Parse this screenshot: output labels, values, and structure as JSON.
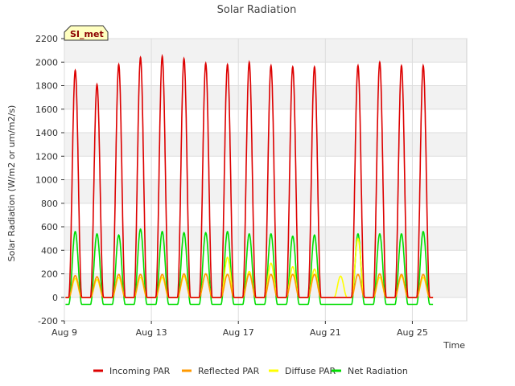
{
  "chart_data": {
    "type": "line",
    "title": "Solar Radiation",
    "xlabel": "Time",
    "ylabel": "Solar Radiation (W/m2 or um/m2/s)",
    "ylim": [
      -200,
      2200
    ],
    "xlim": [
      0,
      18.5
    ],
    "yticks": [
      -200,
      0,
      200,
      400,
      600,
      800,
      1000,
      1200,
      1400,
      1600,
      1800,
      2000,
      2200
    ],
    "xticks": [
      {
        "label": "Aug 9",
        "day": 0
      },
      {
        "label": "Aug 13",
        "day": 4
      },
      {
        "label": "Aug 17",
        "day": 8
      },
      {
        "label": "Aug 21",
        "day": 12
      },
      {
        "label": "Aug 25",
        "day": 16
      }
    ],
    "grid": true,
    "legend_position": "bottom",
    "site_label": "SI_met",
    "series": [
      {
        "name": "Incoming PAR",
        "color": "#dd0000",
        "x_day": [
          0.5,
          1.5,
          2.5,
          3.5,
          4.5,
          5.5,
          6.5,
          7.5,
          8.5,
          9.5,
          10.5,
          11.5,
          13.5,
          14.5,
          15.5,
          16.5
        ],
        "peak_values": [
          1930,
          1810,
          1980,
          2040,
          2050,
          2030,
          1990,
          1980,
          2000,
          1970,
          1960,
          1960,
          1970,
          2000,
          1970,
          1970
        ]
      },
      {
        "name": "Reflected PAR",
        "color": "#ff9900",
        "x_day": [
          0.5,
          1.5,
          2.5,
          3.5,
          4.5,
          5.5,
          6.5,
          7.5,
          8.5,
          9.5,
          10.5,
          11.5,
          13.5,
          14.5,
          15.5,
          16.5
        ],
        "peak_values": [
          185,
          175,
          195,
          195,
          195,
          200,
          200,
          195,
          200,
          195,
          195,
          195,
          195,
          200,
          195,
          195
        ]
      },
      {
        "name": "Diffuse PAR",
        "color": "#ffff00",
        "x_day": [
          0.5,
          1.5,
          2.5,
          3.5,
          4.5,
          5.5,
          6.5,
          7.5,
          8.5,
          9.5,
          10.5,
          11.5,
          12.7,
          13.5,
          14.5,
          15.5,
          16.5
        ],
        "peak_values": [
          160,
          150,
          170,
          170,
          170,
          180,
          200,
          340,
          220,
          290,
          260,
          240,
          180,
          500,
          170,
          180,
          170
        ]
      },
      {
        "name": "Net Radiation",
        "color": "#00dd00",
        "x_day": [
          0.5,
          1.5,
          2.5,
          3.5,
          4.5,
          5.5,
          6.5,
          7.5,
          8.5,
          9.5,
          10.5,
          11.5,
          13.5,
          14.5,
          15.5,
          16.5
        ],
        "peak_values": [
          560,
          540,
          530,
          580,
          560,
          550,
          550,
          560,
          540,
          540,
          520,
          530,
          540,
          540,
          540,
          560
        ],
        "night_value": -60
      }
    ]
  }
}
